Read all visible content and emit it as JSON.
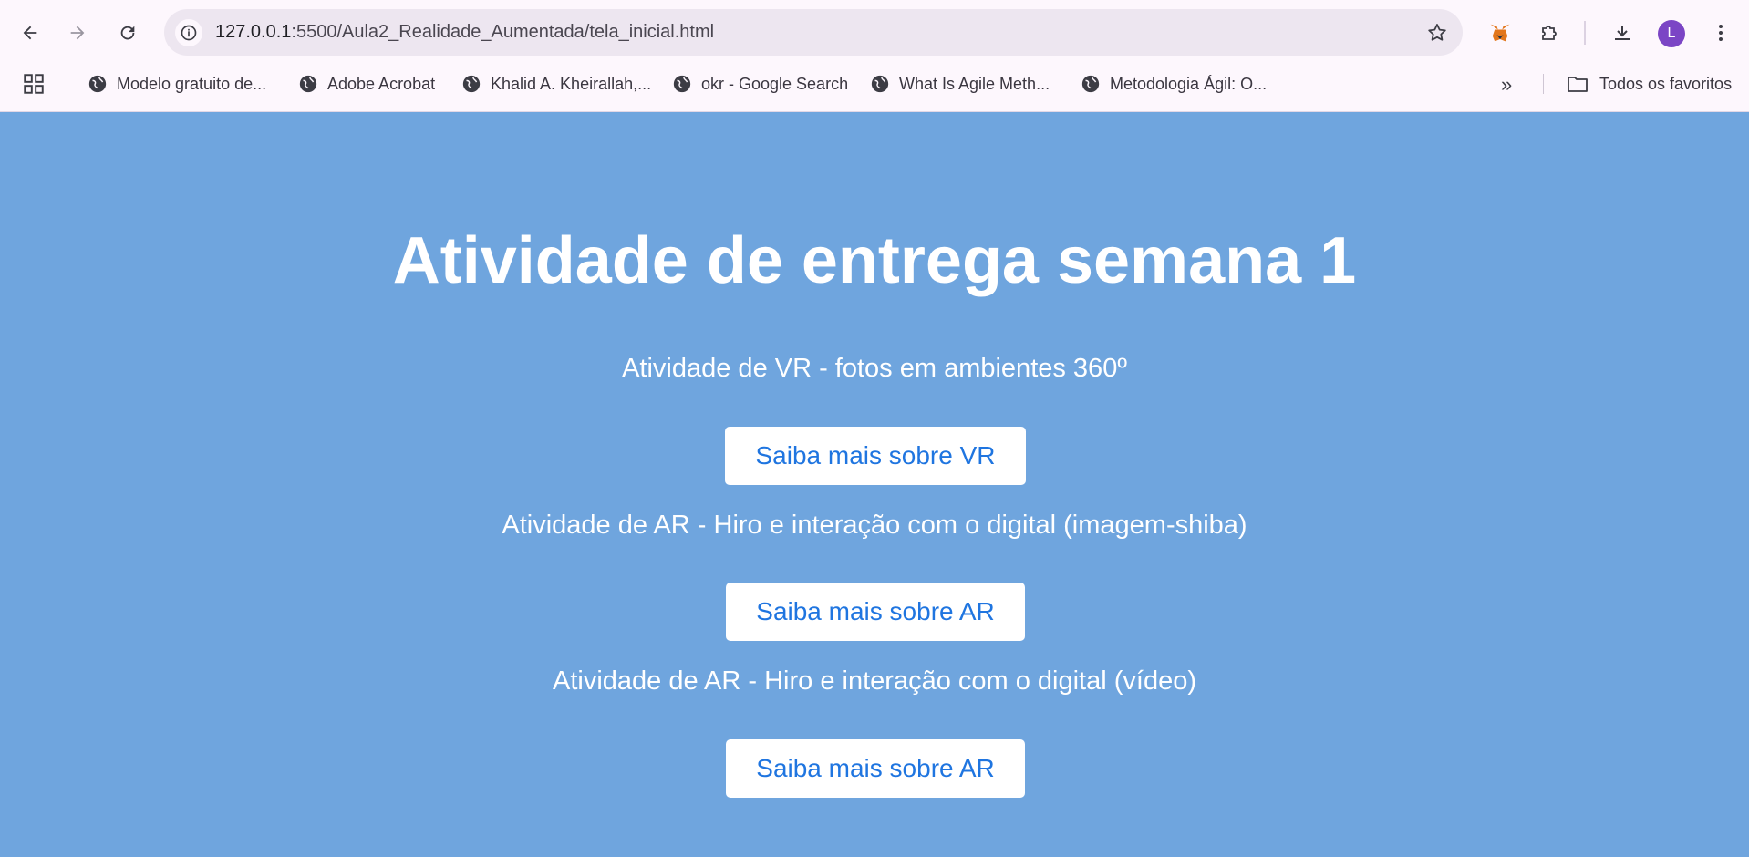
{
  "browser": {
    "url_host": "127.0.0.1",
    "url_path": ":5500/Aula2_Realidade_Aumentada/tela_inicial.html",
    "profile_initial": "L",
    "icons": [
      "back-icon",
      "forward-icon",
      "reload-icon",
      "site-info-icon",
      "bookmark-star-icon",
      "metamask-fox-icon",
      "extensions-icon",
      "download-icon",
      "kebab-menu-icon"
    ]
  },
  "bookmarks": {
    "items": [
      {
        "label": "Modelo gratuito de..."
      },
      {
        "label": "Adobe Acrobat"
      },
      {
        "label": "Khalid A. Kheirallah,..."
      },
      {
        "label": "okr - Google Search"
      },
      {
        "label": "What Is Agile Meth..."
      },
      {
        "label": "Metodologia Ágil: O..."
      }
    ],
    "more": "»",
    "all_bookmarks": "Todos os favoritos"
  },
  "page": {
    "background": "#6fa5de",
    "title": "Atividade de entrega semana 1",
    "activities": [
      {
        "text": "Atividade de VR - fotos em ambientes 360º",
        "button": "Saiba mais sobre VR"
      },
      {
        "text": "Atividade de AR - Hiro e interação com o digital (imagem-shiba)",
        "button": "Saiba mais sobre AR"
      },
      {
        "text": "Atividade de AR - Hiro e interação com o digital (vídeo)",
        "button": "Saiba mais sobre AR"
      }
    ],
    "button_text_color": "#1f75e0"
  }
}
